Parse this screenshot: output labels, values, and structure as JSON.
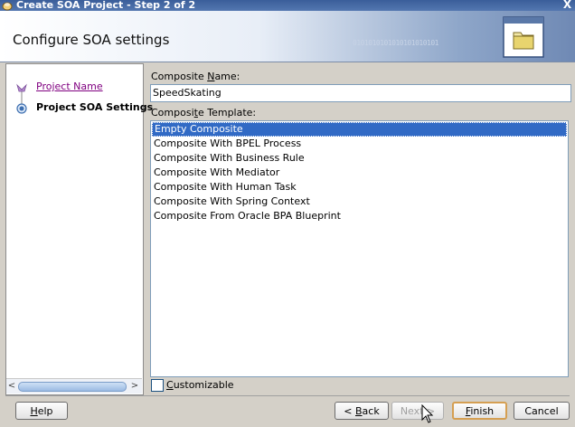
{
  "window": {
    "title": "Create SOA Project - Step 2 of 2",
    "close_glyph": "X"
  },
  "header": {
    "title": "Configure SOA settings",
    "binary_decoration": "0101010101010101010101"
  },
  "nav": {
    "items": [
      {
        "label": "Project Name",
        "state": "visited"
      },
      {
        "label": "Project SOA Settings",
        "state": "current"
      }
    ],
    "scroll_left_glyph": "<",
    "scroll_right_glyph": ">"
  },
  "form": {
    "composite_name": {
      "label_prefix": "Composite ",
      "label_mnemonic": "N",
      "label_suffix": "ame:",
      "value": "SpeedSkating"
    },
    "composite_template": {
      "label_prefix": "Composi",
      "label_mnemonic": "t",
      "label_suffix": "e Template:",
      "selected_index": 0,
      "options": [
        "Empty Composite",
        "Composite With BPEL Process",
        "Composite With Business Rule",
        "Composite With Mediator",
        "Composite With Human Task",
        "Composite With Spring Context",
        "Composite From Oracle BPA Blueprint"
      ]
    },
    "customizable": {
      "label_mnemonic": "C",
      "label_rest": "ustomizable",
      "checked": false
    }
  },
  "buttons": {
    "help": {
      "mnemonic": "H",
      "rest": "elp"
    },
    "back": {
      "prefix": "< ",
      "mnemonic": "B",
      "rest": "ack"
    },
    "next": {
      "label": "Next >",
      "enabled": false
    },
    "finish": {
      "mnemonic": "F",
      "rest": "inish"
    },
    "cancel": {
      "label": "Cancel"
    }
  },
  "colors": {
    "selection": "#316ac5",
    "title_bar": "#3a5e9a",
    "visited_link": "#800080",
    "default_button_border": "#d59f52"
  }
}
